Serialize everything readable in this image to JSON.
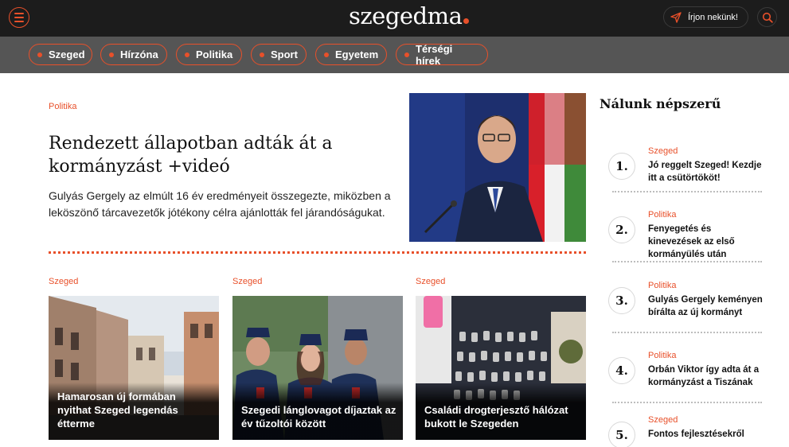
{
  "header": {
    "logo": "szegedma",
    "write_label": "Írjon nekünk!"
  },
  "nav": {
    "items": [
      {
        "label": "Szeged"
      },
      {
        "label": "Hírzóna"
      },
      {
        "label": "Politika"
      },
      {
        "label": "Sport"
      },
      {
        "label": "Egyetem"
      },
      {
        "label": "Térségi hírek"
      }
    ]
  },
  "hero": {
    "category": "Politika",
    "title": "Rendezett állapotban adták át a kormányzást +videó",
    "lead": "Gulyás Gergely az elmúlt 16 év eredményeit összegezte, miközben a leköszönő tárcavezetők jótékony célra ajánlották fel járandóságukat."
  },
  "cards": [
    {
      "category": "Szeged",
      "title": "Hamarosan új formában nyithat Szeged legendás étterme"
    },
    {
      "category": "Szeged",
      "title": "Szegedi lánglovagot díjaztak az év tűzoltói között"
    },
    {
      "category": "Szeged",
      "title": "Családi drogterjesztő hálózat bukott le Szegeden"
    }
  ],
  "sidebar": {
    "title": "Nálunk népszerű",
    "items": [
      {
        "num": "1.",
        "category": "Szeged",
        "title": "Jó reggelt Szeged! Kezdje itt a csütörtököt!"
      },
      {
        "num": "2.",
        "category": "Politika",
        "title": "Fenyegetés és kinevezések az első kormányülés után"
      },
      {
        "num": "3.",
        "category": "Politika",
        "title": "Gulyás Gergely keményen bírálta az új kormányt"
      },
      {
        "num": "4.",
        "category": "Politika",
        "title": "Orbán Viktor így adta át a kormányzást a Tiszának"
      },
      {
        "num": "5.",
        "category": "Szeged",
        "title": "Fontos fejlesztésekről"
      }
    ]
  },
  "colors": {
    "accent": "#e8502a",
    "topbar": "#1c1c1c",
    "navbar": "#555555"
  },
  "icons": [
    "menu-icon",
    "send-icon",
    "search-icon"
  ]
}
